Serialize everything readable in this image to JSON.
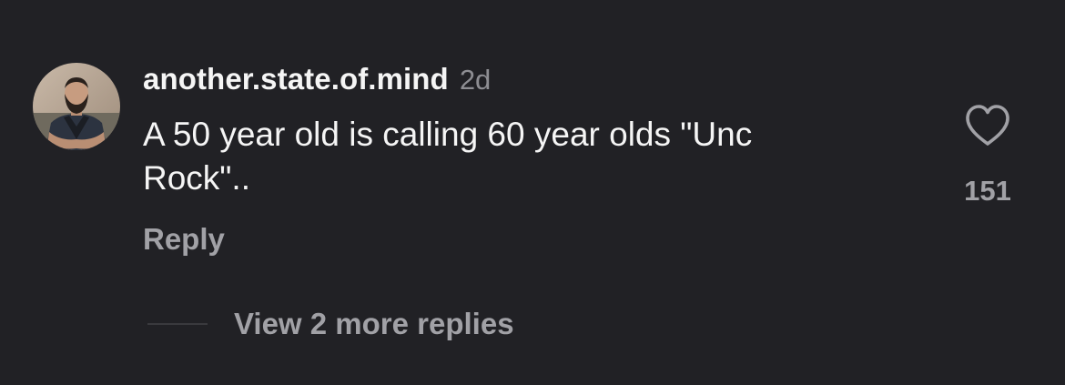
{
  "comment": {
    "username": "another.state.of.mind",
    "timestamp": "2d",
    "text": "A 50 year old is calling 60 year olds \"Unc\nRock\"..",
    "like_count": "151",
    "reply_label": "Reply",
    "view_replies_label": "View 2 more replies",
    "heart_icon": "heart-outline-icon",
    "avatar_icon": "user-avatar-photo"
  },
  "colors": {
    "background": "#212125",
    "primary_text": "#f5f5f5",
    "secondary_text": "#a1a1a6",
    "muted_text": "#8e8e93",
    "divider": "#3a3a3e"
  }
}
